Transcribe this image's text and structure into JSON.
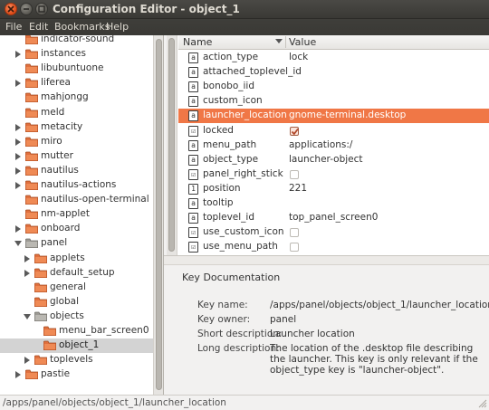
{
  "window": {
    "title": "Configuration Editor - object_1"
  },
  "menu": [
    "File",
    "Edit",
    "Bookmarks",
    "Help"
  ],
  "tree": [
    {
      "label": "indicator-sound",
      "expander": "none",
      "folder": "closed",
      "selected": false
    },
    {
      "label": "instances",
      "expander": "collapsed",
      "folder": "closed",
      "selected": false
    },
    {
      "label": "libubuntuone",
      "expander": "none",
      "folder": "closed",
      "selected": false
    },
    {
      "label": "liferea",
      "expander": "collapsed",
      "folder": "closed",
      "selected": false
    },
    {
      "label": "mahjongg",
      "expander": "none",
      "folder": "closed",
      "selected": false
    },
    {
      "label": "meld",
      "expander": "none",
      "folder": "closed",
      "selected": false
    },
    {
      "label": "metacity",
      "expander": "collapsed",
      "folder": "closed",
      "selected": false
    },
    {
      "label": "miro",
      "expander": "collapsed",
      "folder": "closed",
      "selected": false
    },
    {
      "label": "mutter",
      "expander": "collapsed",
      "folder": "closed",
      "selected": false
    },
    {
      "label": "nautilus",
      "expander": "collapsed",
      "folder": "closed",
      "selected": false
    },
    {
      "label": "nautilus-actions",
      "expander": "collapsed",
      "folder": "closed",
      "selected": false
    },
    {
      "label": "nautilus-open-terminal",
      "expander": "none",
      "folder": "closed",
      "selected": false
    },
    {
      "label": "nm-applet",
      "expander": "none",
      "folder": "closed",
      "selected": false
    },
    {
      "label": "onboard",
      "expander": "collapsed",
      "folder": "closed",
      "selected": false
    },
    {
      "label": "panel",
      "expander": "expanded",
      "folder": "open",
      "selected": false
    },
    {
      "label": "applets",
      "expander": "collapsed",
      "folder": "closed",
      "selected": false
    },
    {
      "label": "default_setup",
      "expander": "collapsed",
      "folder": "closed",
      "selected": false
    },
    {
      "label": "general",
      "expander": "none",
      "folder": "closed",
      "selected": false
    },
    {
      "label": "global",
      "expander": "none",
      "folder": "closed",
      "selected": false
    },
    {
      "label": "objects",
      "expander": "expanded",
      "folder": "open",
      "selected": false
    },
    {
      "label": "menu_bar_screen0",
      "expander": "none",
      "folder": "closed",
      "selected": false
    },
    {
      "label": "object_1",
      "expander": "none",
      "folder": "closed",
      "selected": true
    },
    {
      "label": "toplevels",
      "expander": "collapsed",
      "folder": "closed",
      "selected": false
    },
    {
      "label": "pastie",
      "expander": "collapsed",
      "folder": "closed",
      "selected": false
    }
  ],
  "columns": {
    "name": "Name",
    "value": "Value"
  },
  "keys": [
    {
      "name": "action_type",
      "type": "string",
      "value": "lock",
      "selected": false
    },
    {
      "name": "attached_toplevel_id",
      "type": "string",
      "value": "",
      "selected": false
    },
    {
      "name": "bonobo_iid",
      "type": "string",
      "value": "",
      "selected": false
    },
    {
      "name": "custom_icon",
      "type": "string",
      "value": "",
      "selected": false
    },
    {
      "name": "launcher_location",
      "type": "string",
      "value": "gnome-terminal.desktop",
      "selected": true
    },
    {
      "name": "locked",
      "type": "bool",
      "value": "",
      "checked": true,
      "selected": false
    },
    {
      "name": "menu_path",
      "type": "string",
      "value": "applications:/",
      "selected": false
    },
    {
      "name": "object_type",
      "type": "string",
      "value": "launcher-object",
      "selected": false
    },
    {
      "name": "panel_right_stick",
      "type": "bool",
      "value": "",
      "checked": false,
      "selected": false
    },
    {
      "name": "position",
      "type": "int",
      "value": "221",
      "selected": false
    },
    {
      "name": "tooltip",
      "type": "string",
      "value": "",
      "selected": false
    },
    {
      "name": "toplevel_id",
      "type": "string",
      "value": "top_panel_screen0",
      "selected": false
    },
    {
      "name": "use_custom_icon",
      "type": "bool",
      "value": "",
      "checked": false,
      "selected": false
    },
    {
      "name": "use_menu_path",
      "type": "bool",
      "value": "",
      "checked": false,
      "selected": false
    }
  ],
  "key_icons": {
    "string": "a",
    "bool": "☑",
    "int": "1"
  },
  "doc": {
    "title": "Key Documentation",
    "key_name_label": "Key name:",
    "key_name": "/apps/panel/objects/object_1/launcher_location",
    "key_owner_label": "Key owner:",
    "key_owner": "panel",
    "short_desc_label": "Short description:",
    "short_desc": "Launcher location",
    "long_desc_label": "Long description:",
    "long_desc": "The location of the .desktop file describing the launcher. This key is only relevant if the object_type key is \"launcher-object\"."
  },
  "status": "/apps/panel/objects/object_1/launcher_location",
  "colors": {
    "selection": "#f07746",
    "folder": "#e0703e",
    "folder_open": "#9c9a94",
    "titlebar": "#3c3b37"
  }
}
